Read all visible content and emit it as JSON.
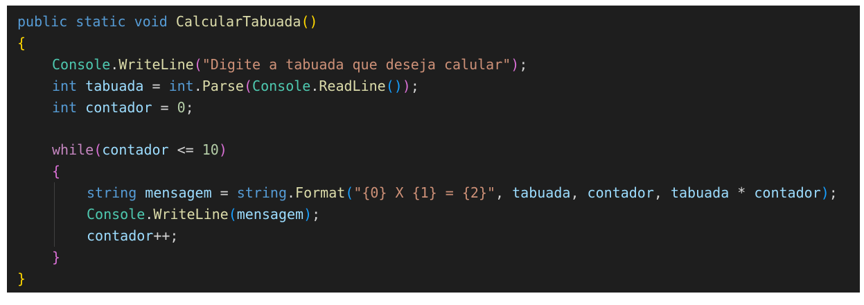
{
  "editor": {
    "language": "csharp",
    "theme": "dark",
    "background_color": "#1e1e1e",
    "lines": [
      {
        "indent": 0,
        "guides": [],
        "tokens": [
          {
            "text": "public",
            "kind": "keyword"
          },
          {
            "text": " ",
            "kind": "plain"
          },
          {
            "text": "static",
            "kind": "keyword"
          },
          {
            "text": " ",
            "kind": "plain"
          },
          {
            "text": "void",
            "kind": "keyword"
          },
          {
            "text": " ",
            "kind": "plain"
          },
          {
            "text": "CalcularTabuada",
            "kind": "method"
          },
          {
            "text": "()",
            "kind": "brace-gold"
          }
        ]
      },
      {
        "indent": 0,
        "guides": [],
        "tokens": [
          {
            "text": "{",
            "kind": "brace-gold"
          }
        ]
      },
      {
        "indent": 1,
        "guides": [],
        "tokens": [
          {
            "text": "Console",
            "kind": "type"
          },
          {
            "text": ".",
            "kind": "punct"
          },
          {
            "text": "WriteLine",
            "kind": "method"
          },
          {
            "text": "(",
            "kind": "brace-purple"
          },
          {
            "text": "\"Digite a tabuada que deseja calular\"",
            "kind": "string"
          },
          {
            "text": ")",
            "kind": "brace-purple"
          },
          {
            "text": ";",
            "kind": "punct"
          }
        ]
      },
      {
        "indent": 1,
        "guides": [],
        "tokens": [
          {
            "text": "int",
            "kind": "keyword"
          },
          {
            "text": " ",
            "kind": "plain"
          },
          {
            "text": "tabuada",
            "kind": "variable"
          },
          {
            "text": " = ",
            "kind": "operator"
          },
          {
            "text": "int",
            "kind": "keyword"
          },
          {
            "text": ".",
            "kind": "punct"
          },
          {
            "text": "Parse",
            "kind": "method"
          },
          {
            "text": "(",
            "kind": "brace-purple"
          },
          {
            "text": "Console",
            "kind": "type"
          },
          {
            "text": ".",
            "kind": "punct"
          },
          {
            "text": "ReadLine",
            "kind": "method"
          },
          {
            "text": "()",
            "kind": "brace-blue"
          },
          {
            "text": ")",
            "kind": "brace-purple"
          },
          {
            "text": ";",
            "kind": "punct"
          }
        ]
      },
      {
        "indent": 1,
        "guides": [],
        "tokens": [
          {
            "text": "int",
            "kind": "keyword"
          },
          {
            "text": " ",
            "kind": "plain"
          },
          {
            "text": "contador",
            "kind": "variable"
          },
          {
            "text": " = ",
            "kind": "operator"
          },
          {
            "text": "0",
            "kind": "number"
          },
          {
            "text": ";",
            "kind": "punct"
          }
        ]
      },
      {
        "indent": 0,
        "guides": [],
        "tokens": []
      },
      {
        "indent": 1,
        "guides": [],
        "tokens": [
          {
            "text": "while",
            "kind": "control"
          },
          {
            "text": "(",
            "kind": "brace-purple"
          },
          {
            "text": "contador",
            "kind": "variable"
          },
          {
            "text": " <= ",
            "kind": "operator"
          },
          {
            "text": "10",
            "kind": "number"
          },
          {
            "text": ")",
            "kind": "brace-purple"
          }
        ]
      },
      {
        "indent": 1,
        "guides": [],
        "tokens": [
          {
            "text": "{",
            "kind": "brace-purple"
          }
        ]
      },
      {
        "indent": 2,
        "guides": [
          1
        ],
        "tokens": [
          {
            "text": "string",
            "kind": "keyword"
          },
          {
            "text": " ",
            "kind": "plain"
          },
          {
            "text": "mensagem",
            "kind": "variable"
          },
          {
            "text": " = ",
            "kind": "operator"
          },
          {
            "text": "string",
            "kind": "keyword"
          },
          {
            "text": ".",
            "kind": "punct"
          },
          {
            "text": "Format",
            "kind": "method"
          },
          {
            "text": "(",
            "kind": "brace-blue"
          },
          {
            "text": "\"{0} X {1} = {2}\"",
            "kind": "string"
          },
          {
            "text": ", ",
            "kind": "punct"
          },
          {
            "text": "tabuada",
            "kind": "variable"
          },
          {
            "text": ", ",
            "kind": "punct"
          },
          {
            "text": "contador",
            "kind": "variable"
          },
          {
            "text": ", ",
            "kind": "punct"
          },
          {
            "text": "tabuada",
            "kind": "variable"
          },
          {
            "text": " * ",
            "kind": "operator"
          },
          {
            "text": "contador",
            "kind": "variable"
          },
          {
            "text": ")",
            "kind": "brace-blue"
          },
          {
            "text": ";",
            "kind": "punct"
          }
        ]
      },
      {
        "indent": 2,
        "guides": [
          1
        ],
        "tokens": [
          {
            "text": "Console",
            "kind": "type"
          },
          {
            "text": ".",
            "kind": "punct"
          },
          {
            "text": "WriteLine",
            "kind": "method"
          },
          {
            "text": "(",
            "kind": "brace-blue"
          },
          {
            "text": "mensagem",
            "kind": "variable"
          },
          {
            "text": ")",
            "kind": "brace-blue"
          },
          {
            "text": ";",
            "kind": "punct"
          }
        ]
      },
      {
        "indent": 2,
        "guides": [
          1
        ],
        "tokens": [
          {
            "text": "contador",
            "kind": "variable"
          },
          {
            "text": "++;",
            "kind": "operator"
          }
        ]
      },
      {
        "indent": 1,
        "guides": [],
        "tokens": [
          {
            "text": "}",
            "kind": "brace-purple"
          }
        ]
      },
      {
        "indent": 0,
        "guides": [],
        "tokens": [
          {
            "text": "}",
            "kind": "brace-gold"
          }
        ]
      }
    ]
  }
}
